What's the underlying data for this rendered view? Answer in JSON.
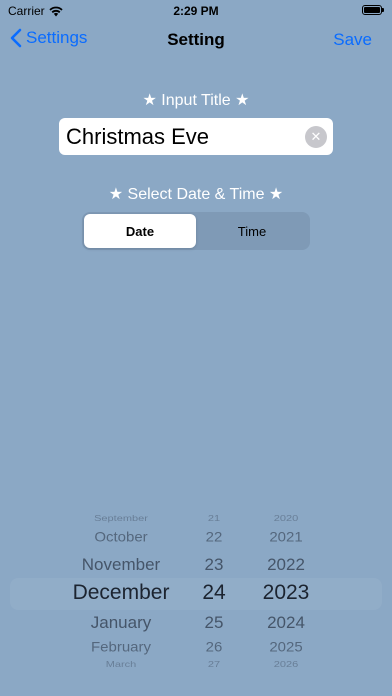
{
  "status_bar": {
    "carrier": "Carrier",
    "time": "2:29 PM"
  },
  "nav": {
    "back_label": "Settings",
    "title": "Setting",
    "save_label": "Save"
  },
  "title_section": {
    "label": "★ Input Title ★",
    "value": "Christmas Eve"
  },
  "datetime_section": {
    "label": "★ Select Date & Time ★",
    "segments": [
      "Date",
      "Time"
    ],
    "selected_segment": "Date"
  },
  "picker": {
    "months": [
      "September",
      "October",
      "November",
      "December",
      "January",
      "February",
      "March"
    ],
    "days": [
      "21",
      "22",
      "23",
      "24",
      "25",
      "26",
      "27"
    ],
    "years": [
      "2020",
      "2021",
      "2022",
      "2023",
      "2024",
      "2025",
      "2026"
    ],
    "selected": {
      "month": "December",
      "day": "24",
      "year": "2023"
    }
  },
  "colors": {
    "background": "#8ba8c5",
    "accent": "#0a6cff",
    "label_text": "#ffffff"
  }
}
